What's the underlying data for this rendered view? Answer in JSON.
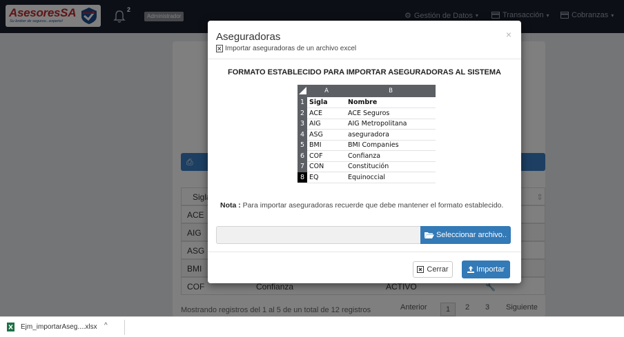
{
  "navbar": {
    "logo_text": "AsesoresSA",
    "logo_tagline": "Su bróker de seguros...experto!",
    "notification_count": "2",
    "role": "Administrador",
    "menus": [
      {
        "label": "Gestión de Datos",
        "icon": "gear-icon"
      },
      {
        "label": "Transacción",
        "icon": "card-icon"
      },
      {
        "label": "Cobranzas",
        "icon": "card-icon"
      }
    ]
  },
  "background": {
    "table_header_first": "Sigla",
    "rows": [
      {
        "sigla": "ACE"
      },
      {
        "sigla": "AIG"
      },
      {
        "sigla": "ASG"
      },
      {
        "sigla": "BMI"
      },
      {
        "sigla": "COF",
        "nombre": "Confianza",
        "estado": "ACTIVO"
      }
    ],
    "footer": "Mostrando registros del 1 al 5 de un total de 12 registros",
    "pager": {
      "prev": "Anterior",
      "pages": [
        "1",
        "2",
        "3"
      ],
      "next": "Siguiente"
    }
  },
  "modal": {
    "title": "Aseguradoras",
    "subtitle": "Importar aseguradoras de un archivo excel",
    "close": "×",
    "format_title": "FORMATO ESTABLECIDO PARA IMPORTAR ASEGURADORAS AL SISTEMA",
    "sheet": {
      "columns": [
        "A",
        "B"
      ],
      "rows": [
        {
          "n": "1",
          "a": "Sigla",
          "b": "Nombre"
        },
        {
          "n": "2",
          "a": "ACE",
          "b": "ACE Seguros"
        },
        {
          "n": "3",
          "a": "AIG",
          "b": "AIG Metropolitana"
        },
        {
          "n": "4",
          "a": "ASG",
          "b": "aseguradora"
        },
        {
          "n": "5",
          "a": "BMI",
          "b": "BMI Companies"
        },
        {
          "n": "6",
          "a": "COF",
          "b": "Confianza"
        },
        {
          "n": "7",
          "a": "CON",
          "b": "Constitución"
        },
        {
          "n": "8",
          "a": "EQ",
          "b": "Equinoccial"
        }
      ]
    },
    "note_label": "Nota :",
    "note_text": "Para importar aseguradoras recuerde que debe mantener el formato establecido.",
    "file_input_value": "",
    "select_file_label": "Seleccionar archivo..",
    "cancel_label": "Cerrar",
    "import_label": "Importar"
  },
  "download_bar": {
    "file_name": "Ejm_importarAseg....xlsx",
    "caret": "^"
  },
  "colors": {
    "navbar_bg": "#1a1f2c",
    "primary": "#337ab7",
    "brand_red": "#c0262b"
  }
}
